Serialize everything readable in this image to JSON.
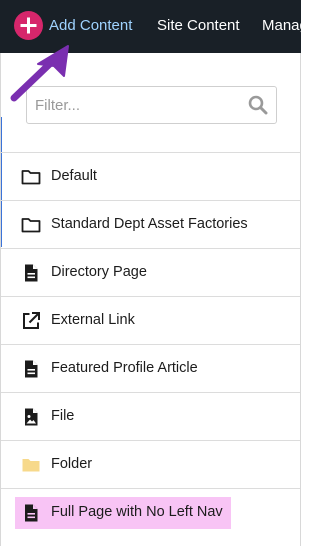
{
  "topbar": {
    "add_content": "Add Content",
    "site_content": "Site Content",
    "manage": "Manag"
  },
  "filter": {
    "placeholder": "Filter..."
  },
  "items": [
    {
      "label": "Default",
      "icon": "folder-outline-icon"
    },
    {
      "label": "Standard Dept Asset Factories",
      "icon": "folder-outline-icon"
    },
    {
      "label": "Directory Page",
      "icon": "document-icon"
    },
    {
      "label": "External Link",
      "icon": "external-link-icon"
    },
    {
      "label": "Featured Profile Article",
      "icon": "document-icon"
    },
    {
      "label": "File",
      "icon": "file-image-icon"
    },
    {
      "label": "Folder",
      "icon": "folder-filled-icon"
    },
    {
      "label": "Full Page with No Left Nav",
      "icon": "document-icon"
    }
  ],
  "colors": {
    "topbar_bg": "#192027",
    "add_button": "#d6266b",
    "add_label": "#9fd3ff",
    "arrow": "#7a2fb0",
    "highlight": "#f8c4f5",
    "folder_yellow": "#f7d98b"
  }
}
